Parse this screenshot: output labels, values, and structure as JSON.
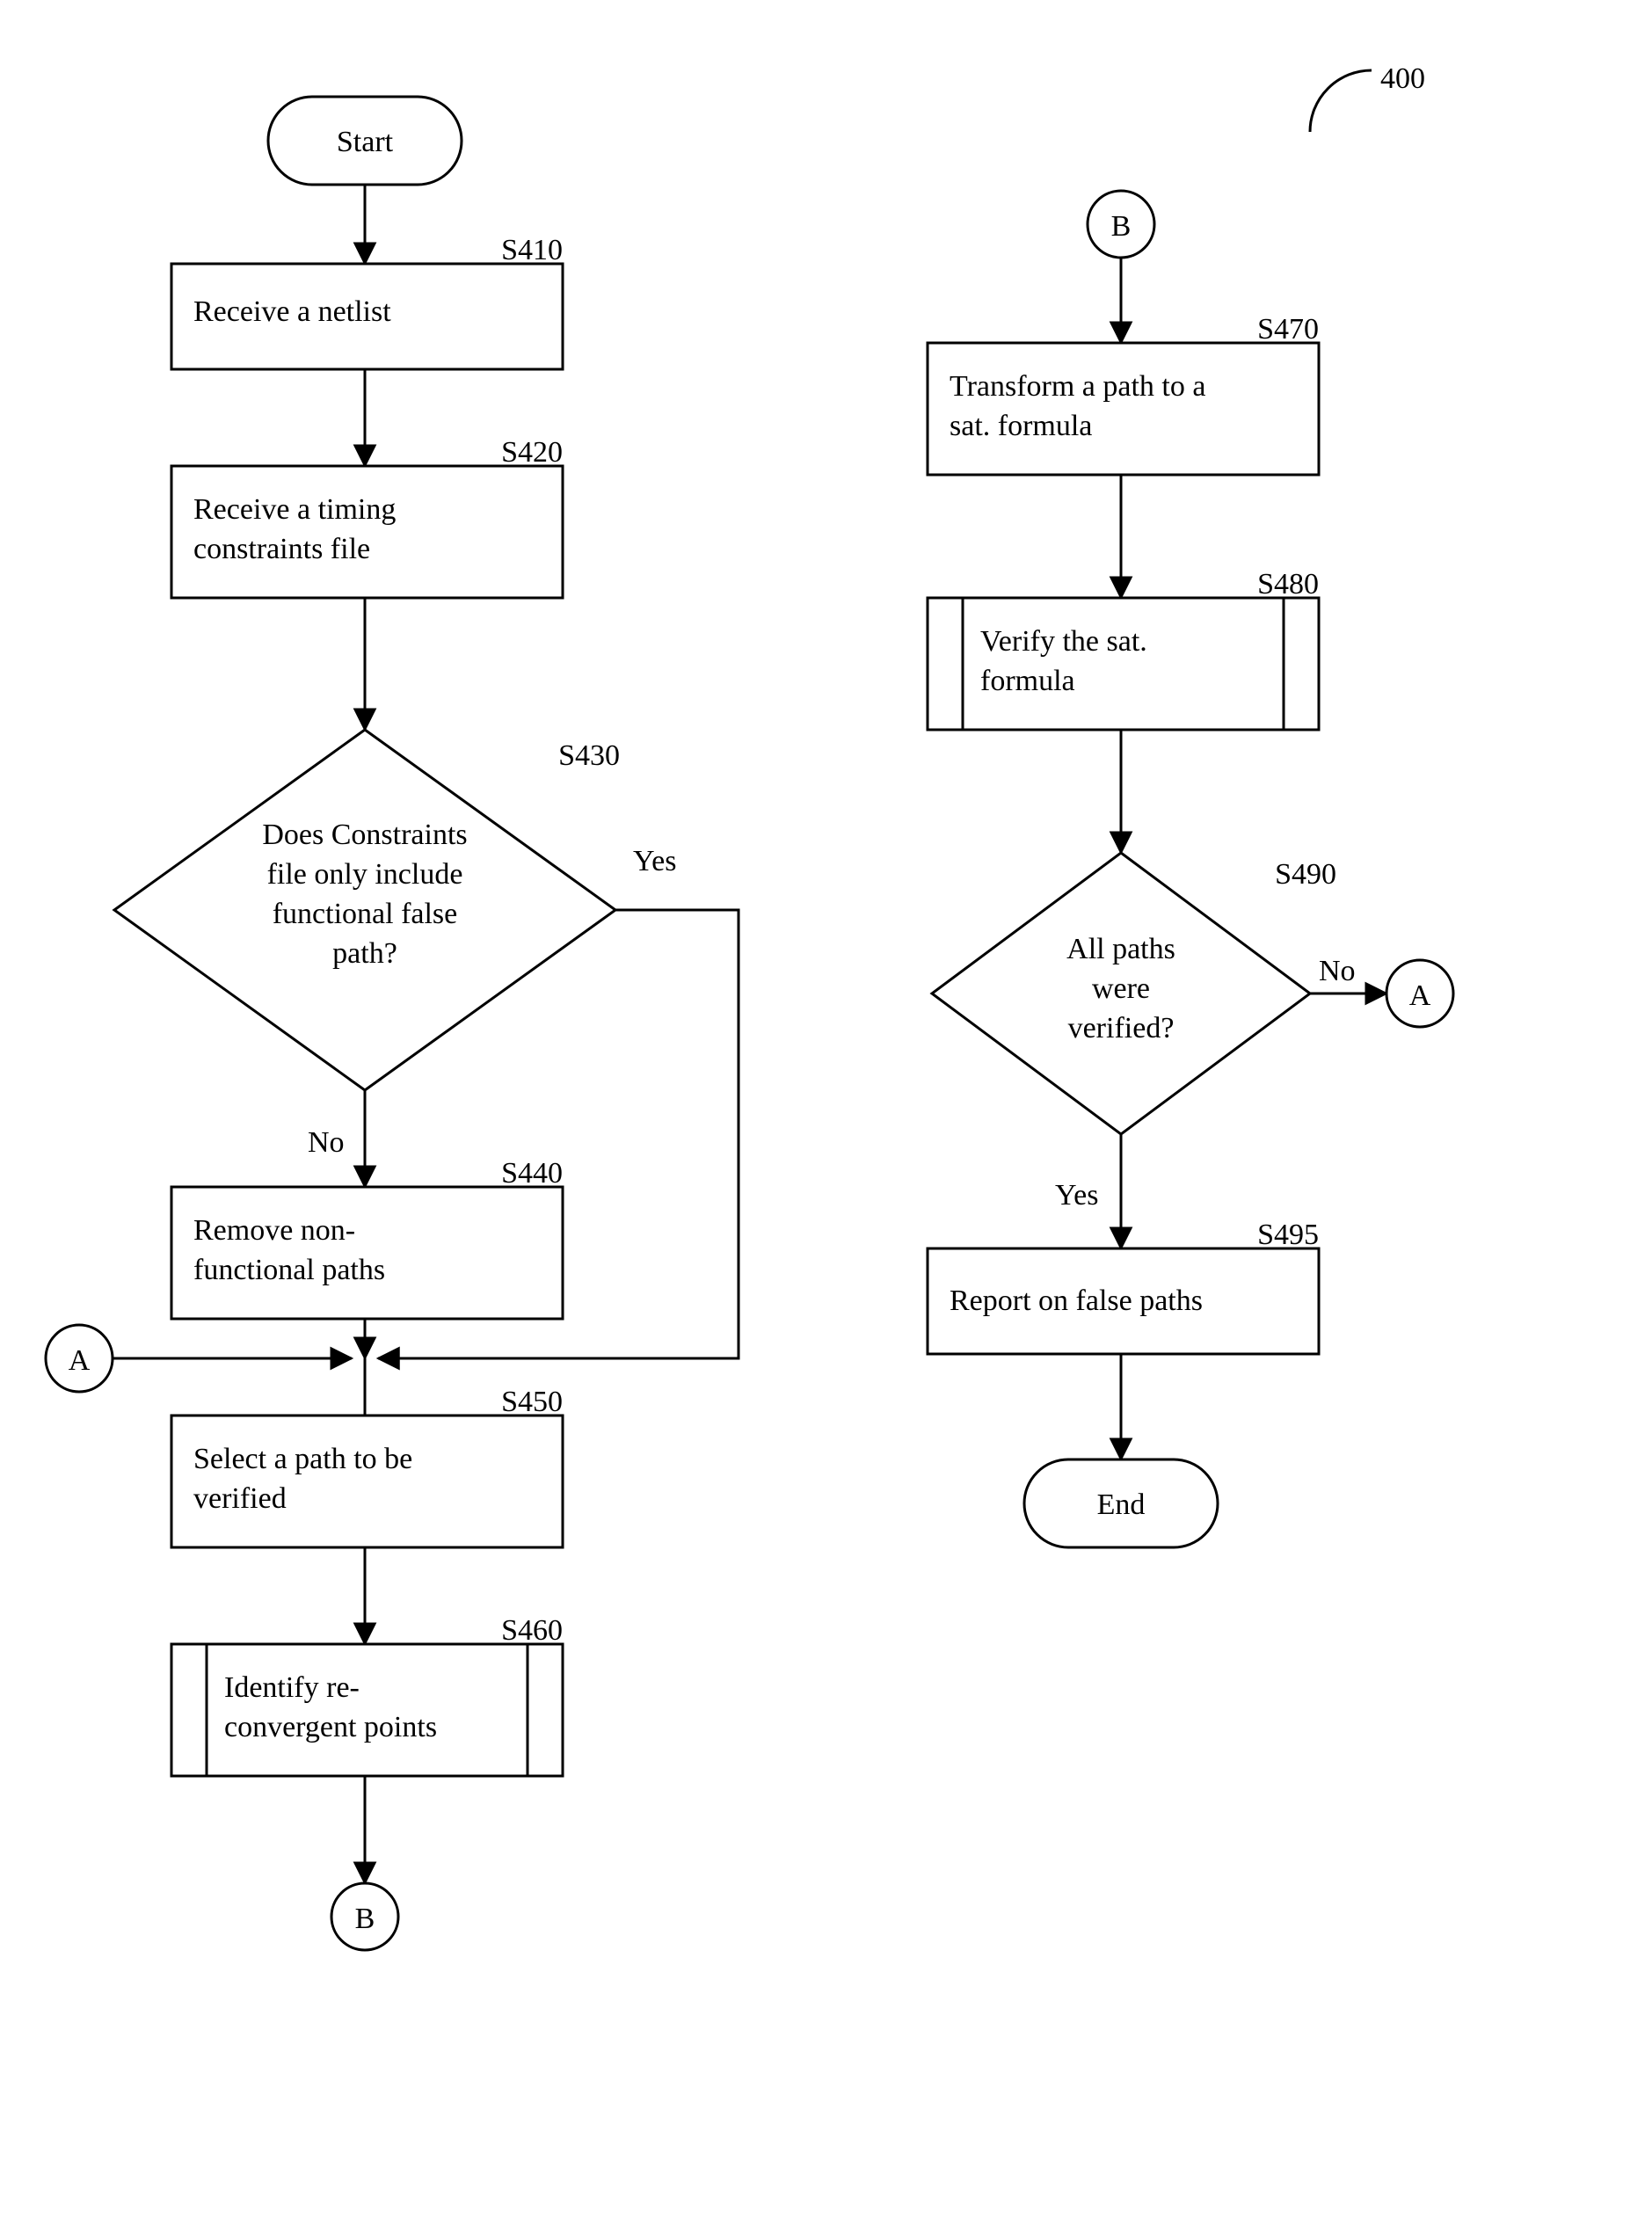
{
  "figure_id": "400",
  "terminals": {
    "start": "Start",
    "end": "End"
  },
  "connectors": {
    "a": "A",
    "b": "B"
  },
  "steps": {
    "s410": {
      "ref": "S410",
      "text_l1": "Receive a netlist"
    },
    "s420": {
      "ref": "S420",
      "text_l1": "Receive a timing",
      "text_l2": "constraints file"
    },
    "s430": {
      "ref": "S430",
      "text_l1": "Does Constraints",
      "text_l2": "file only include",
      "text_l3": "functional false",
      "text_l4": "path?",
      "yes": "Yes",
      "no": "No"
    },
    "s440": {
      "ref": "S440",
      "text_l1": "Remove non-",
      "text_l2": "functional paths"
    },
    "s450": {
      "ref": "S450",
      "text_l1": "Select a path to be",
      "text_l2": "verified"
    },
    "s460": {
      "ref": "S460",
      "text_l1": "Identify re-",
      "text_l2": "convergent points"
    },
    "s470": {
      "ref": "S470",
      "text_l1": "Transform a path to a",
      "text_l2": "sat. formula"
    },
    "s480": {
      "ref": "S480",
      "text_l1": "Verify the sat.",
      "text_l2": "formula"
    },
    "s490": {
      "ref": "S490",
      "text_l1": "All paths",
      "text_l2": "were",
      "text_l3": "verified?",
      "yes": "Yes",
      "no": "No"
    },
    "s495": {
      "ref": "S495",
      "text_l1": "Report on false paths"
    }
  }
}
